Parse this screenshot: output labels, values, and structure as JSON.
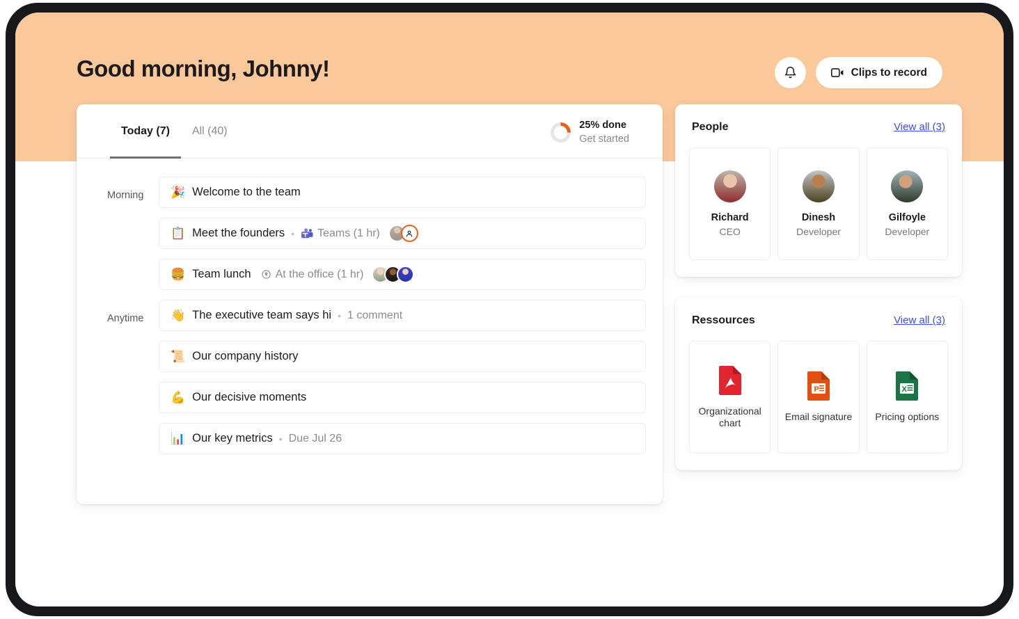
{
  "header": {
    "greeting": "Good morning, Johnny!",
    "notification_icon": "bell-icon",
    "clips_button_label": "Clips to record",
    "clips_icon": "video-clip-icon",
    "band_color": "#fbc89a"
  },
  "main": {
    "tabs": [
      {
        "label": "Today (7)",
        "active": true
      },
      {
        "label": "All (40)",
        "active": false
      }
    ],
    "progress": {
      "percent": 25,
      "percent_label": "25% done",
      "sub_label": "Get started",
      "arc_color": "#e8601c",
      "track_color": "#e6e6e6"
    },
    "groups": [
      {
        "label": "Morning",
        "tasks": [
          {
            "emoji": "🎉",
            "title": "Welcome to the team",
            "meta": "",
            "meta_icon": "",
            "avatars": []
          },
          {
            "emoji": "📋",
            "title": "Meet the founders",
            "meta": "Teams (1 hr)",
            "meta_icon": "microsoft-teams-icon",
            "avatars": [
              "photo-richard",
              "ghost-person"
            ]
          },
          {
            "emoji": "🍔",
            "title": "Team lunch",
            "meta": "At the office (1 hr)",
            "meta_icon": "location-pin-icon",
            "avatars": [
              "photo-a",
              "photo-b",
              "photo-c"
            ]
          }
        ]
      },
      {
        "label": "Anytime",
        "tasks": [
          {
            "emoji": "👋",
            "title": "The executive team says hi",
            "meta": "1 comment",
            "meta_icon": "",
            "avatars": []
          },
          {
            "emoji": "📜",
            "title": "Our company history",
            "meta": "",
            "meta_icon": "",
            "avatars": []
          },
          {
            "emoji": "💪",
            "title": "Our decisive moments",
            "meta": "",
            "meta_icon": "",
            "avatars": []
          },
          {
            "emoji": "📊",
            "title": "Our key metrics",
            "meta": "Due Jul 26",
            "meta_icon": "",
            "avatars": []
          }
        ]
      }
    ]
  },
  "people_panel": {
    "title": "People",
    "link": "View all (3)",
    "members": [
      {
        "name": "Richard",
        "role": "CEO"
      },
      {
        "name": "Dinesh",
        "role": "Developer"
      },
      {
        "name": "Gilfoyle",
        "role": "Developer"
      }
    ]
  },
  "resources_panel": {
    "title": "Ressources",
    "link": "View all (3)",
    "files": [
      {
        "label": "Organizational chart",
        "icon": "pdf-file-icon",
        "color": "#e2252f"
      },
      {
        "label": "Email signature",
        "icon": "powerpoint-file-icon",
        "color": "#e1500f"
      },
      {
        "label": "Pricing options",
        "icon": "excel-file-icon",
        "color": "#1a7544"
      }
    ]
  }
}
